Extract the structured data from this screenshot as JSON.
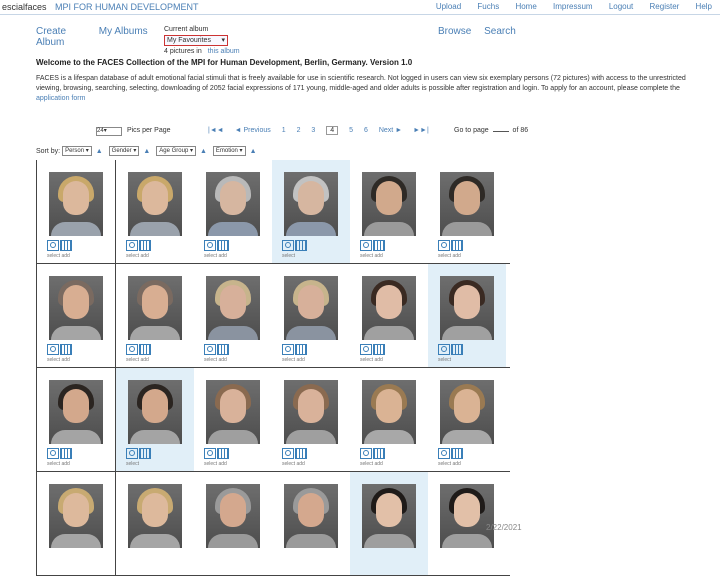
{
  "header": {
    "brand": "escialfaces",
    "brand_sub": "MPI FOR HUMAN DEVELOPMENT",
    "links": [
      "Upload",
      "Fuchs",
      "Home",
      "Impressum",
      "Logout",
      "Register",
      "Help"
    ]
  },
  "nav": {
    "create_album": "Create Album",
    "my_albums": "My Albums",
    "current_album_label": "Current album",
    "album_selected": "My Favourites",
    "album_count": "4 pictures in",
    "album_link": "this album",
    "browse": "Browse",
    "search": "Search"
  },
  "welcome": "Welcome to the FACES Collection of the MPI for Human Development, Berlin, Germany. Version 1.0",
  "description": "FACES is a lifespan database of adult emotional facial stimuli that is freely available for use in scientific research. Not logged in users can view six exemplary persons (72 pictures) with access to the unrestricted viewing, browsing, searching, selecting, downloading of 2052 facial expressions of 171 young, middle-aged and older adults is possible after registration and login. To apply for an account, please complete the",
  "description_link": "application form",
  "pager": {
    "per_page": "24",
    "per_page_label": "Pics per Page",
    "first": "|◄◄",
    "prev": "◄ Previous",
    "pages": [
      "1",
      "2",
      "3",
      "4",
      "5",
      "6"
    ],
    "current": "4",
    "next": "Next ►",
    "last": "►►|",
    "goto_label": "Go to page",
    "goto_suffix": "of 86"
  },
  "sort": {
    "label": "Sort by:",
    "options": [
      "Person",
      "Gender",
      "Age Group",
      "Emotion"
    ],
    "extra": "▲"
  },
  "grid": {
    "rows": [
      [
        {
          "hair": "#c9a86a",
          "face": "#dcb89c",
          "shirt": "#9aa2ac",
          "caption": "select  add",
          "hl": false
        },
        {
          "hair": "#c9a86a",
          "face": "#dcb89c",
          "shirt": "#9aa2ac",
          "caption": "select  add",
          "hl": false
        },
        {
          "hair": "#b9b9b9",
          "face": "#d6b6a0",
          "shirt": "#8b98aa",
          "caption": "select  add",
          "hl": false
        },
        {
          "hair": "#c2c2c2",
          "face": "#d6b6a0",
          "shirt": "#8b98aa",
          "caption": "select",
          "hl": true
        },
        {
          "hair": "#2e2a26",
          "face": "#d1a98c",
          "shirt": "#9a9a9a",
          "caption": "select  add",
          "hl": false
        },
        {
          "hair": "#2e2a26",
          "face": "#d1a98c",
          "shirt": "#9a9a9a",
          "caption": "select  add",
          "hl": false
        }
      ],
      [
        {
          "hair": "#7a6a60",
          "face": "#d8ae92",
          "shirt": "#a5a5a5",
          "caption": "select  add",
          "hl": false
        },
        {
          "hair": "#7a6a60",
          "face": "#d8ae92",
          "shirt": "#a5a5a5",
          "caption": "select  add",
          "hl": false
        },
        {
          "hair": "#c7b48c",
          "face": "#d7b09a",
          "shirt": "#8a93a0",
          "caption": "select  add",
          "hl": false
        },
        {
          "hair": "#c7b48c",
          "face": "#d7b09a",
          "shirt": "#8a93a0",
          "caption": "select  add",
          "hl": false
        },
        {
          "hair": "#3a2a22",
          "face": "#e0bca6",
          "shirt": "#a0a0a0",
          "caption": "select  add",
          "hl": false
        },
        {
          "hair": "#3a2a22",
          "face": "#e0bca6",
          "shirt": "#a0a0a0",
          "caption": "select",
          "hl": true
        }
      ],
      [
        {
          "hair": "#2b2521",
          "face": "#d3a88c",
          "shirt": "#a4a4a4",
          "caption": "select  add",
          "hl": false
        },
        {
          "hair": "#2b2521",
          "face": "#d3a88c",
          "shirt": "#a4a4a4",
          "caption": "select",
          "hl": true
        },
        {
          "hair": "#8a6a50",
          "face": "#d9b29a",
          "shirt": "#9f9f9f",
          "caption": "select  add",
          "hl": false
        },
        {
          "hair": "#8a6a50",
          "face": "#d9b29a",
          "shirt": "#9f9f9f",
          "caption": "select  add",
          "hl": false
        },
        {
          "hair": "#9a7a52",
          "face": "#dab394",
          "shirt": "#a8a8a8",
          "caption": "select  add",
          "hl": false
        },
        {
          "hair": "#9a7a52",
          "face": "#dab394",
          "shirt": "#a8a8a8",
          "caption": "select  add",
          "hl": false
        }
      ],
      [
        {
          "hair": "#c8aa72",
          "face": "#ddb99c",
          "shirt": "#a5a5a5",
          "caption": "",
          "hl": false
        },
        {
          "hair": "#c8aa72",
          "face": "#ddb99c",
          "shirt": "#a5a5a5",
          "caption": "",
          "hl": false
        },
        {
          "hair": "#9a9a9a",
          "face": "#d4a88e",
          "shirt": "#9a9a9a",
          "caption": "",
          "hl": false
        },
        {
          "hair": "#9a9a9a",
          "face": "#d4a88e",
          "shirt": "#9a9a9a",
          "caption": "",
          "hl": false
        },
        {
          "hair": "#1f1b19",
          "face": "#e2c0a8",
          "shirt": "#9e9e9e",
          "caption": "",
          "hl": true
        },
        {
          "hair": "#1f1b19",
          "face": "#e2c0a8",
          "shirt": "#9e9e9e",
          "caption": "",
          "hl": false
        }
      ]
    ]
  },
  "footer_date": "2/22/2021"
}
